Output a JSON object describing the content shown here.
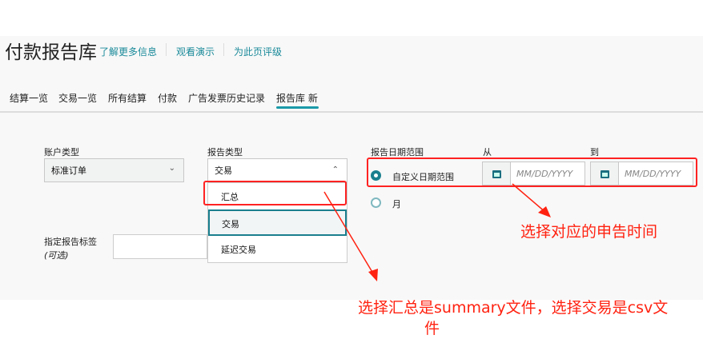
{
  "header": {
    "title": "付款报告库",
    "links": [
      "了解更多信息",
      "观看演示",
      "为此页评级"
    ]
  },
  "tabs": [
    "结算一览",
    "交易一览",
    "所有结算",
    "付款",
    "广告发票历史记录",
    "报告库 新"
  ],
  "account_type": {
    "label": "账户类型",
    "value": "标准订单"
  },
  "report_type": {
    "label": "报告类型",
    "value": "交易",
    "options": [
      "汇总",
      "交易",
      "延迟交易"
    ],
    "selected": "交易"
  },
  "report_tag": {
    "label": "指定报告标签",
    "optional": "(可选)",
    "value": ""
  },
  "date_range": {
    "label": "报告日期范围",
    "from_label": "从",
    "to_label": "到",
    "custom_label": "自定义日期范围",
    "month_label": "月",
    "from_placeholder": "MM/DD/YYYY",
    "to_placeholder": "MM/DD/YYYY",
    "selected": "custom"
  },
  "annotations": {
    "date_note": "选择对应的申告时间",
    "type_note_line1": "选择汇总是summary文件，选择交易是csv文",
    "type_note_line2": "件"
  },
  "colors": {
    "accent": "#1a7f8e",
    "annotation": "#ff2211"
  }
}
